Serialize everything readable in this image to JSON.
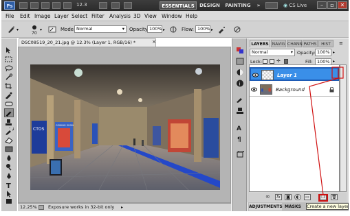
{
  "app": {
    "logo": "Ps",
    "zoom": "12.3",
    "workspaces": [
      "ESSENTIALS",
      "DESIGN",
      "PAINTING",
      "»"
    ],
    "cs_live": "CS Live",
    "window_buttons": [
      "–",
      "▫",
      "✕"
    ]
  },
  "menu": [
    "File",
    "Edit",
    "Image",
    "Layer",
    "Select",
    "Filter",
    "Analysis",
    "3D",
    "View",
    "Window",
    "Help"
  ],
  "options": {
    "brush_size": "70",
    "mode_label": "Mode:",
    "mode_value": "Normal",
    "opacity_label": "Opacity:",
    "opacity_value": "100%",
    "flow_label": "Flow:",
    "flow_value": "100%"
  },
  "document": {
    "tab_title": "DSC08519_20_21.jpg @ 12.3% (Layer 1, RGB/16) *",
    "close": "×",
    "zoom_status": "12.25%",
    "status_message": "Exposure works in 32-bit only",
    "photo_signs": [
      "CTOS",
      "COMING SOON"
    ]
  },
  "layers_panel": {
    "tabs": [
      "LAYERS",
      "NAVIG",
      "CHANN",
      "PATHS",
      "HIST"
    ],
    "blend_mode": "Normal",
    "opacity_label": "Opacity:",
    "opacity_value": "100%",
    "lock_label": "Lock:",
    "fill_label": "Fill:",
    "fill_value": "100%",
    "layers": [
      {
        "name": "Layer 1",
        "selected": true
      },
      {
        "name": "Background",
        "selected": false
      }
    ],
    "bottom_tabs": [
      "ADJUSTMENTS",
      "MASKS"
    ],
    "tooltip": "Create a new layer"
  },
  "colors": {
    "selection": "#3a8fe8",
    "annotation": "#d01010",
    "app_bar": "#333333"
  }
}
